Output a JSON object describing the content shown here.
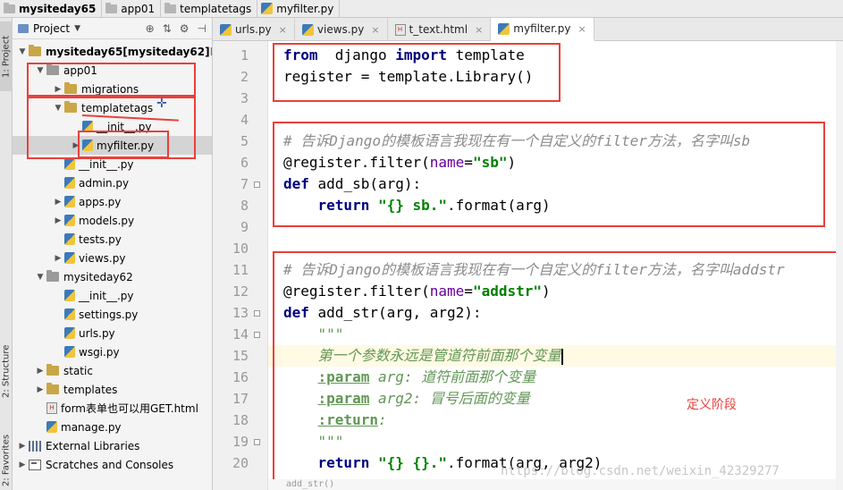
{
  "breadcrumb": [
    "mysiteday65",
    "app01",
    "templatetags",
    "myfilter.py"
  ],
  "tool_strip": {
    "project": "1: Project",
    "structure": "2: Structure",
    "favorites": "2: Favorites"
  },
  "panel": {
    "title": "Project"
  },
  "tree": [
    {
      "label": "mysiteday65",
      "extra": " [mysiteday62]",
      "path": " D:",
      "icon": "folder",
      "arrow": "down",
      "indent": 0
    },
    {
      "label": "app01",
      "icon": "package",
      "arrow": "down",
      "indent": 1
    },
    {
      "label": "migrations",
      "icon": "folder",
      "arrow": "right",
      "indent": 2
    },
    {
      "label": "templatetags",
      "icon": "folder",
      "arrow": "down",
      "indent": 2
    },
    {
      "label": "__init__.py",
      "icon": "py",
      "arrow": "",
      "indent": 3
    },
    {
      "label": "myfilter.py",
      "icon": "py",
      "arrow": "right",
      "indent": 3,
      "selected": true
    },
    {
      "label": "__init__.py",
      "icon": "py",
      "arrow": "",
      "indent": 2
    },
    {
      "label": "admin.py",
      "icon": "py",
      "arrow": "",
      "indent": 2
    },
    {
      "label": "apps.py",
      "icon": "py",
      "arrow": "right",
      "indent": 2
    },
    {
      "label": "models.py",
      "icon": "py",
      "arrow": "right",
      "indent": 2
    },
    {
      "label": "tests.py",
      "icon": "py",
      "arrow": "",
      "indent": 2
    },
    {
      "label": "views.py",
      "icon": "py",
      "arrow": "right",
      "indent": 2
    },
    {
      "label": "mysiteday62",
      "icon": "package",
      "arrow": "down",
      "indent": 1
    },
    {
      "label": "__init__.py",
      "icon": "py",
      "arrow": "",
      "indent": 2
    },
    {
      "label": "settings.py",
      "icon": "py",
      "arrow": "",
      "indent": 2
    },
    {
      "label": "urls.py",
      "icon": "py",
      "arrow": "",
      "indent": 2
    },
    {
      "label": "wsgi.py",
      "icon": "py",
      "arrow": "",
      "indent": 2
    },
    {
      "label": "static",
      "icon": "folder",
      "arrow": "right",
      "indent": 1
    },
    {
      "label": "templates",
      "icon": "folder",
      "arrow": "right",
      "indent": 1
    },
    {
      "label": "form表单也可以用GET.html",
      "icon": "html",
      "arrow": "",
      "indent": 1
    },
    {
      "label": "manage.py",
      "icon": "py",
      "arrow": "",
      "indent": 1
    },
    {
      "label": "External Libraries",
      "icon": "lib",
      "arrow": "right",
      "indent": 0
    },
    {
      "label": "Scratches and Consoles",
      "icon": "scratch",
      "arrow": "right",
      "indent": 0
    }
  ],
  "tabs": [
    {
      "label": "urls.py",
      "icon": "py",
      "active": false
    },
    {
      "label": "views.py",
      "icon": "py",
      "active": false
    },
    {
      "label": "t_text.html",
      "icon": "html",
      "active": false
    },
    {
      "label": "myfilter.py",
      "icon": "py",
      "active": true
    }
  ],
  "editor": {
    "highlight_line": 15,
    "lines": [
      {
        "n": "1",
        "parts": [
          [
            "kw",
            "from"
          ],
          [
            "",
            "  django "
          ],
          [
            "kw",
            "import"
          ],
          [
            "",
            " template"
          ]
        ]
      },
      {
        "n": "2",
        "parts": [
          [
            "",
            "register = template.Library()"
          ]
        ]
      },
      {
        "n": "3",
        "parts": []
      },
      {
        "n": "4",
        "parts": []
      },
      {
        "n": "5",
        "parts": [
          [
            "cmt",
            "# 告诉Django的模板语言我现在有一个自定义的filter方法，名字叫sb"
          ]
        ]
      },
      {
        "n": "6",
        "parts": [
          [
            "",
            "@register.filter("
          ],
          [
            "prm",
            "name"
          ],
          [
            "",
            "="
          ],
          [
            "str",
            "\"sb\""
          ],
          [
            "",
            ")"
          ]
        ]
      },
      {
        "n": "7",
        "parts": [
          [
            "kw",
            "def"
          ],
          [
            "",
            " add_sb(arg):"
          ]
        ]
      },
      {
        "n": "8",
        "parts": [
          [
            "",
            "    "
          ],
          [
            "kw",
            "return"
          ],
          [
            "",
            " "
          ],
          [
            "str",
            "\"{} sb.\""
          ],
          [
            "",
            ".format(arg)"
          ]
        ]
      },
      {
        "n": "9",
        "parts": []
      },
      {
        "n": "10",
        "parts": []
      },
      {
        "n": "11",
        "parts": [
          [
            "cmt",
            "# 告诉Django的模板语言我现在有一个自定义的filter方法，名字叫addstr"
          ]
        ]
      },
      {
        "n": "12",
        "parts": [
          [
            "",
            "@register.filter("
          ],
          [
            "prm",
            "name"
          ],
          [
            "",
            "="
          ],
          [
            "str",
            "\"addstr\""
          ],
          [
            "",
            ")"
          ]
        ]
      },
      {
        "n": "13",
        "parts": [
          [
            "kw",
            "def"
          ],
          [
            "",
            " add_str(arg, arg2):"
          ]
        ]
      },
      {
        "n": "14",
        "parts": [
          [
            "",
            "    "
          ],
          [
            "doc",
            "\"\"\""
          ]
        ]
      },
      {
        "n": "15",
        "parts": [
          [
            "",
            "    "
          ],
          [
            "doc",
            "第一个参数永远是管道符前面那个变量"
          ]
        ],
        "caret": true
      },
      {
        "n": "16",
        "parts": [
          [
            "",
            "    "
          ],
          [
            "dtag",
            ":param"
          ],
          [
            "doc",
            " arg: 道符前面那个变量"
          ]
        ]
      },
      {
        "n": "17",
        "parts": [
          [
            "",
            "    "
          ],
          [
            "dtag",
            ":param"
          ],
          [
            "doc",
            " arg2: 冒号后面的变量"
          ]
        ]
      },
      {
        "n": "18",
        "parts": [
          [
            "",
            "    "
          ],
          [
            "dtag",
            ":return"
          ],
          [
            "doc",
            ":"
          ]
        ]
      },
      {
        "n": "19",
        "parts": [
          [
            "",
            "    "
          ],
          [
            "doc",
            "\"\"\""
          ]
        ]
      },
      {
        "n": "20",
        "parts": [
          [
            "",
            "    "
          ],
          [
            "kw",
            "return"
          ],
          [
            "",
            " "
          ],
          [
            "str",
            "\"{} {}.\""
          ],
          [
            "",
            ".format(arg, arg2)"
          ]
        ]
      }
    ],
    "status_crumb": "add_str()"
  },
  "annotation_text": "定义阶段",
  "watermark": "https://blog.csdn.net/weixin_42329277",
  "colors": {
    "annotation_red": "#e8403c",
    "keyword": "#000080",
    "string": "#008000"
  }
}
